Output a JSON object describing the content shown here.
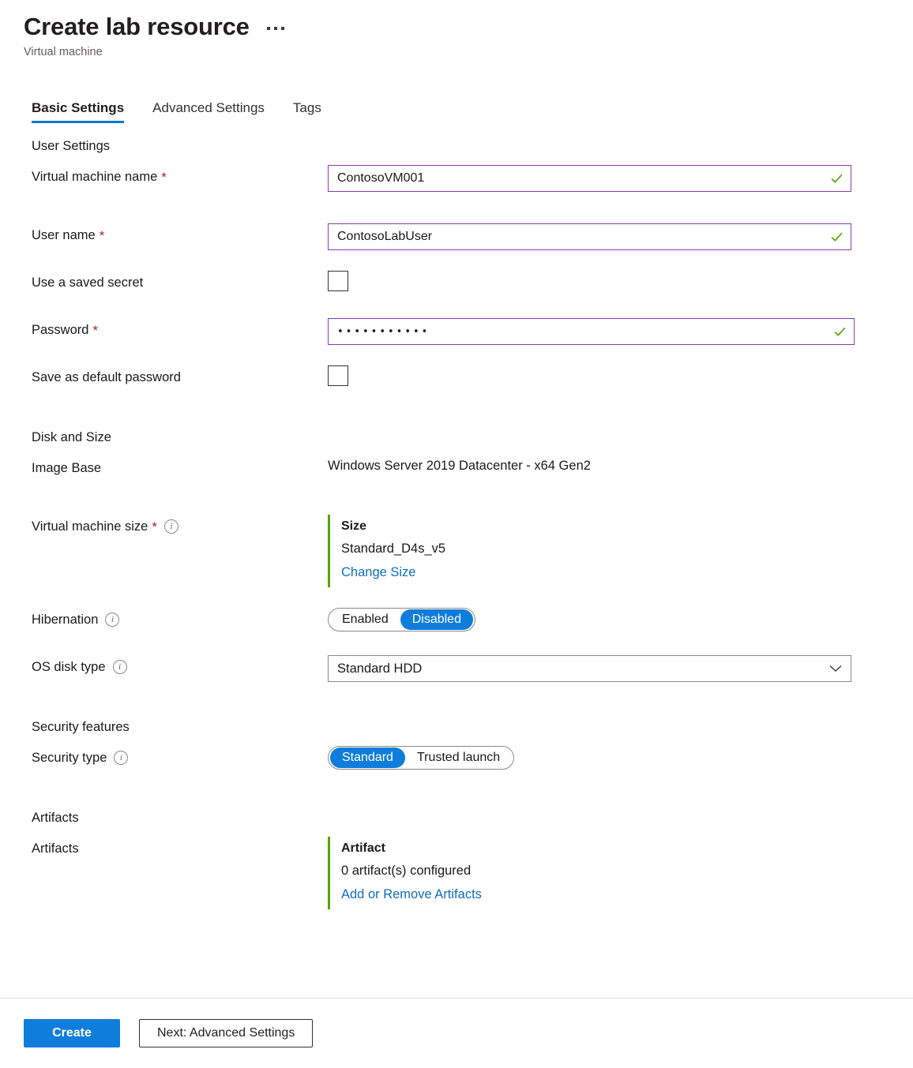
{
  "header": {
    "title": "Create lab resource",
    "subtitle": "Virtual machine",
    "more_icon": "ellipsis-icon"
  },
  "tabs": [
    {
      "label": "Basic Settings",
      "active": true
    },
    {
      "label": "Advanced Settings",
      "active": false
    },
    {
      "label": "Tags",
      "active": false
    }
  ],
  "sections": {
    "user_settings": {
      "heading": "User Settings",
      "vm_name": {
        "label": "Virtual machine name",
        "required": "*",
        "value": "ContosoVM001",
        "placeholder": "",
        "valid_icon": "check-icon"
      },
      "user_name": {
        "label": "User name",
        "required": "*",
        "value": "ContosoLabUser",
        "placeholder": "",
        "valid_icon": "check-icon"
      },
      "use_saved_secret": {
        "label": "Use a saved secret",
        "checked": false
      },
      "password": {
        "label": "Password",
        "required": "*",
        "value": "•••••••••••",
        "placeholder": "",
        "valid_icon": "check-icon"
      },
      "save_default_password": {
        "label": "Save as default password",
        "checked": false
      }
    },
    "disk_and_size": {
      "heading": "Disk and Size",
      "image_base": {
        "label": "Image Base",
        "value": "Windows Server 2019 Datacenter - x64 Gen2"
      },
      "vm_size": {
        "label": "Virtual machine size",
        "required": "*",
        "info_icon": "info-icon",
        "card_title": "Size",
        "card_value": "Standard_D4s_v5",
        "link": "Change Size",
        "accent_color": "#57a300"
      },
      "hibernation": {
        "label": "Hibernation",
        "info_icon": "info-icon",
        "options": [
          "Enabled",
          "Disabled"
        ],
        "selected": "Disabled"
      },
      "os_disk_type": {
        "label": "OS disk type",
        "info_icon": "info-icon",
        "value": "Standard HDD",
        "chevron_icon": "chevron-down-icon"
      }
    },
    "security_features": {
      "heading": "Security features",
      "security_type": {
        "label": "Security type",
        "info_icon": "info-icon",
        "options": [
          "Standard",
          "Trusted launch"
        ],
        "selected": "Standard"
      }
    },
    "artifacts": {
      "heading": "Artifacts",
      "row_label": "Artifacts",
      "card_title": "Artifact",
      "card_value": "0 artifact(s) configured",
      "link": "Add or Remove Artifacts",
      "accent_color": "#57a300"
    }
  },
  "footer": {
    "create_label": "Create",
    "next_label": "Next: Advanced Settings"
  },
  "colors": {
    "accent_blue": "#0f7ddb",
    "tab_underline": "#0078d4",
    "link_blue": "#0f6cbd",
    "required_red": "#a4262c",
    "input_border_valid": "#8a3cb0",
    "check_green": "#5ba300",
    "accent_green": "#57a300"
  }
}
